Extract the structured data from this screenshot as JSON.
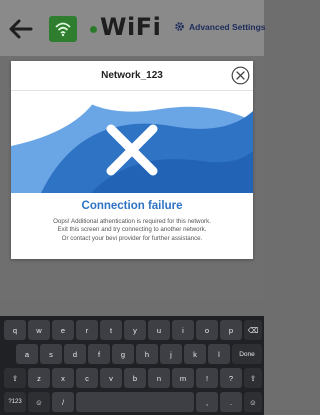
{
  "header": {
    "title": "WiFi",
    "advanced_label": "Advanced Settings",
    "colors": {
      "wifi_green": "#2f7d2f",
      "dot_green": "#2b7a2b",
      "brand_blue": "#2f73c4"
    }
  },
  "modal": {
    "network_name": "Network_123",
    "status_title": "Connection failure",
    "message_lines": [
      "Oops! Additional athentication is required for this network.",
      "Exit this screen and try connecting to another network.",
      "Or contact your bevi provider for further assistance."
    ]
  },
  "keyboard": {
    "row1": [
      "q",
      "w",
      "e",
      "r",
      "t",
      "y",
      "u",
      "i",
      "o",
      "p",
      "⌫"
    ],
    "row2": [
      "a",
      "s",
      "d",
      "f",
      "g",
      "h",
      "j",
      "k",
      "l",
      "Done"
    ],
    "row3": [
      "⇧",
      "z",
      "x",
      "c",
      "v",
      "b",
      "n",
      "m",
      "!",
      "?",
      "⇧"
    ],
    "row4": [
      "?123",
      "☺",
      "/",
      "",
      ",",
      ".",
      "☺"
    ]
  }
}
